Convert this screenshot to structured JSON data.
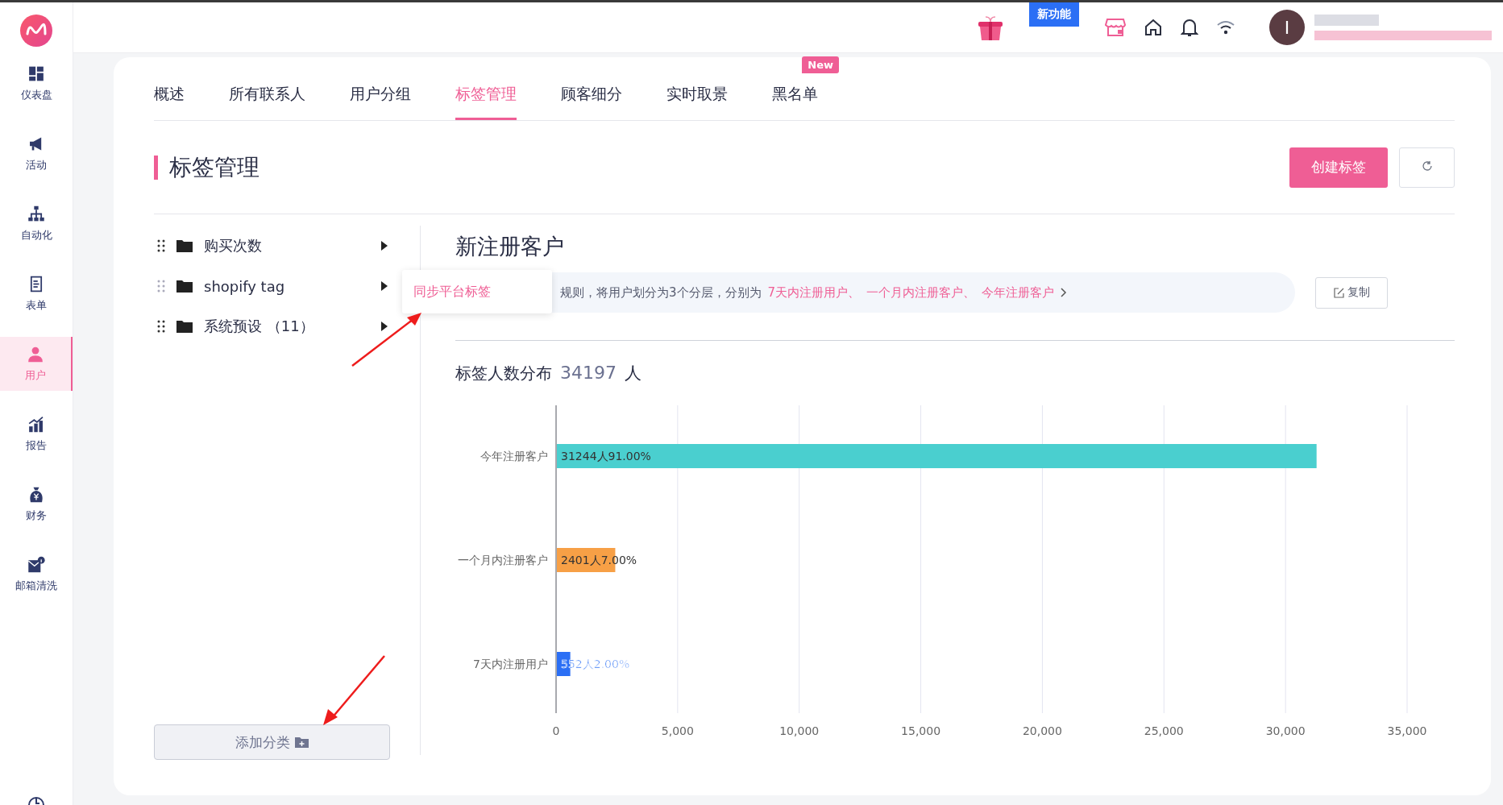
{
  "sidebar": {
    "items": [
      {
        "label": "仪表盘",
        "selected": false
      },
      {
        "label": "活动",
        "selected": false
      },
      {
        "label": "自动化",
        "selected": false
      },
      {
        "label": "表单",
        "selected": false
      },
      {
        "label": "用户",
        "selected": true
      },
      {
        "label": "报告",
        "selected": false
      },
      {
        "label": "财务",
        "selected": false
      },
      {
        "label": "邮箱清洗",
        "selected": false
      }
    ]
  },
  "topbar": {
    "new_feature_badge": "新功能",
    "avatar_initial": "I"
  },
  "tabs": [
    {
      "label": "概述",
      "selected": false
    },
    {
      "label": "所有联系人",
      "selected": false
    },
    {
      "label": "用户分组",
      "selected": false
    },
    {
      "label": "标签管理",
      "selected": true
    },
    {
      "label": "顾客细分",
      "selected": false
    },
    {
      "label": "实时取景",
      "selected": false
    },
    {
      "label": "黑名单",
      "selected": false,
      "badge": "New"
    }
  ],
  "header": {
    "title": "标签管理",
    "create_button": "创建标签"
  },
  "categories": [
    {
      "label": "购买次数"
    },
    {
      "label": "shopify tag"
    },
    {
      "label": "系统预设 （11）"
    }
  ],
  "popup_menu": {
    "item": "同步平台标签"
  },
  "add_category_button": "添加分类",
  "detail": {
    "title": "新注册客户",
    "description": "规则，将用户划分为3个分层，分别为",
    "tags": [
      "7天内注册用户、",
      "一个月内注册客户、",
      "今年注册客户"
    ],
    "copy_button": "复制",
    "distribution_label": "标签人数分布",
    "total": "34197",
    "unit": "人",
    "chart_data": {
      "type": "bar",
      "orientation": "horizontal",
      "categories": [
        "今年注册客户",
        "一个月内注册客户",
        "7天内注册用户"
      ],
      "grid": true,
      "series": [
        {
          "values": [
            31244,
            2401,
            552
          ]
        }
      ],
      "colors": [
        "#4acfcf",
        "#f7a046",
        "#2b6ff5"
      ],
      "value_labels": [
        "31244人91.00%",
        "2401人7.00%",
        "552人2.00%"
      ],
      "xlim": [
        0,
        35000
      ],
      "xticks": [
        {
          "value": 0,
          "label": "0"
        },
        {
          "value": 5000,
          "label": "5,000"
        },
        {
          "value": 10000,
          "label": "10,000"
        },
        {
          "value": 15000,
          "label": "15,000"
        },
        {
          "value": 20000,
          "label": "20,000"
        },
        {
          "value": 25000,
          "label": "25,000"
        },
        {
          "value": 30000,
          "label": "30,000"
        },
        {
          "value": 35000,
          "label": "35,000"
        }
      ]
    }
  }
}
